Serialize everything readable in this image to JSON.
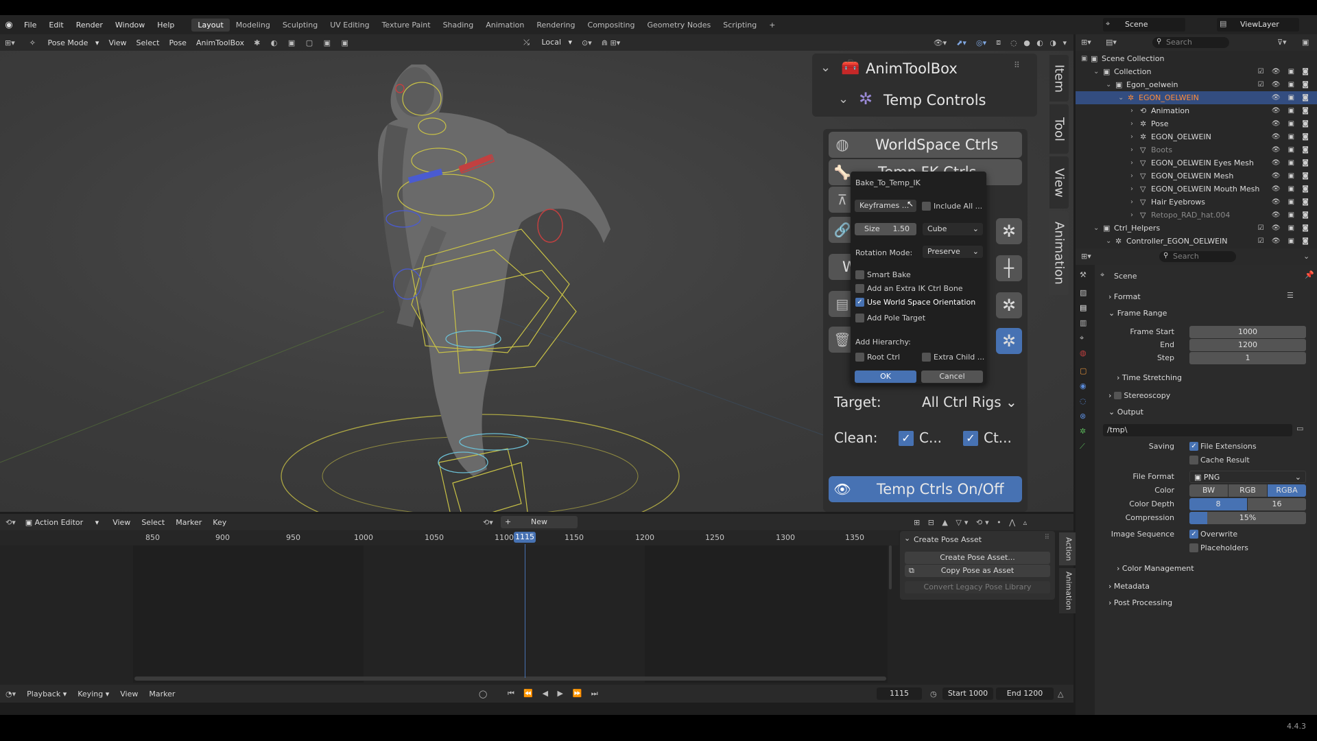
{
  "menus": [
    "File",
    "Edit",
    "Render",
    "Window",
    "Help"
  ],
  "workspaces": [
    "Layout",
    "Modeling",
    "Sculpting",
    "UV Editing",
    "Texture Paint",
    "Shading",
    "Animation",
    "Rendering",
    "Compositing",
    "Geometry Nodes",
    "Scripting",
    "+"
  ],
  "scene_label": "Scene",
  "viewlayer_label": "ViewLayer",
  "header": {
    "mode": "Pose Mode",
    "items": [
      "View",
      "Select",
      "Pose",
      "AnimToolBox"
    ],
    "transform_space": "Local"
  },
  "npanel": {
    "title": "AnimToolBox",
    "subtitle": "Temp Controls",
    "btn_worldspace": "WorldSpace Ctrls",
    "btn_tempfk": "Temp FK Ctrls",
    "btn_w_partial": "W",
    "target_label": "Target:",
    "target_value": "All Ctrl Rigs",
    "clean_label": "Clean:",
    "clean_opt1": "C...",
    "clean_opt2": "Ct...",
    "btn_onoff": "Temp Ctrls On/Off",
    "tabs": [
      "Item",
      "Tool",
      "View",
      "Animation"
    ]
  },
  "popup": {
    "title": "Bake_To_Temp_IK",
    "keyframes": "Keyframes ...",
    "include_all": "Include All ...",
    "size_label": "Size",
    "size_value": "1.50",
    "shape": "Cube",
    "rotation_mode_label": "Rotation Mode:",
    "rotation_mode": "Preserve",
    "smart_bake": "Smart Bake",
    "extra_ik": "Add an Extra IK Ctrl Bone",
    "world_space": "Use World Space Orientation",
    "pole_target": "Add Pole Target",
    "add_hierarchy": "Add Hierarchy:",
    "root_ctrl": "Root Ctrl",
    "extra_child": "Extra Child ...",
    "ok": "OK",
    "cancel": "Cancel"
  },
  "action_editor": {
    "mode": "Action Editor",
    "menus": [
      "View",
      "Select",
      "Marker",
      "Key"
    ],
    "new": "New",
    "ruler": [
      "850",
      "900",
      "950",
      "1000",
      "1050",
      "1100",
      "1150",
      "1200",
      "1250",
      "1300",
      "1350"
    ],
    "current_frame": "1115",
    "sidepanel_title": "Create Pose Asset",
    "btn_create": "Create Pose Asset...",
    "btn_copy": "Copy Pose as Asset",
    "btn_convert": "Convert Legacy Pose Library",
    "tabs": [
      "Action",
      "Animation"
    ]
  },
  "playback": {
    "menus": [
      "Playback",
      "Keying",
      "View",
      "Marker"
    ],
    "frame": "1115",
    "start_label": "Start",
    "start": "1000",
    "end_label": "End",
    "end": "1200"
  },
  "outliner": {
    "search": "Search",
    "rows": [
      {
        "label": "Scene Collection",
        "indent": 0
      },
      {
        "label": "Collection",
        "indent": 1
      },
      {
        "label": "Egon_oelwein",
        "indent": 2
      },
      {
        "label": "EGON_OELWEIN",
        "indent": 3,
        "selected": true
      },
      {
        "label": "Animation",
        "indent": 4
      },
      {
        "label": "Pose",
        "indent": 4
      },
      {
        "label": "EGON_OELWEIN",
        "indent": 4
      },
      {
        "label": "Boots",
        "indent": 4,
        "dim": true
      },
      {
        "label": "EGON_OELWEIN Eyes Mesh",
        "indent": 4
      },
      {
        "label": "EGON_OELWEIN Mesh",
        "indent": 4
      },
      {
        "label": "EGON_OELWEIN Mouth Mesh",
        "indent": 4
      },
      {
        "label": "Hair Eyebrows",
        "indent": 4
      },
      {
        "label": "Retopo_RAD_hat.004",
        "indent": 4,
        "dim": true
      },
      {
        "label": "Ctrl_Helpers",
        "indent": 1
      },
      {
        "label": "Controller_EGON_OELWEIN",
        "indent": 2
      }
    ]
  },
  "properties": {
    "search": "Search",
    "context": "Scene",
    "format": "Format",
    "frame_range": "Frame Range",
    "frame_start_label": "Frame Start",
    "frame_start": "1000",
    "end_label": "End",
    "end": "1200",
    "step_label": "Step",
    "step": "1",
    "time_stretching": "Time Stretching",
    "stereoscopy": "Stereoscopy",
    "output": "Output",
    "output_path": "/tmp\\",
    "saving_label": "Saving",
    "file_extensions": "File Extensions",
    "cache_result": "Cache Result",
    "file_format_label": "File Format",
    "file_format": "PNG",
    "color_label": "Color",
    "color_opts": [
      "BW",
      "RGB",
      "RGBA"
    ],
    "color_depth_label": "Color Depth",
    "depth_opts": [
      "8",
      "16"
    ],
    "compression_label": "Compression",
    "compression": "15%",
    "compression_fraction": 0.15,
    "image_sequence_label": "Image Sequence",
    "overwrite": "Overwrite",
    "placeholders": "Placeholders",
    "color_management": "Color Management",
    "metadata": "Metadata",
    "post_processing": "Post Processing"
  },
  "version": "4.4.3",
  "colors": {
    "accent": "#4772b3",
    "selected_object": "#ff8c3a",
    "rig_yellow": "#c9c246",
    "rig_red": "#c24040",
    "rig_blue": "#4a5bd1"
  }
}
